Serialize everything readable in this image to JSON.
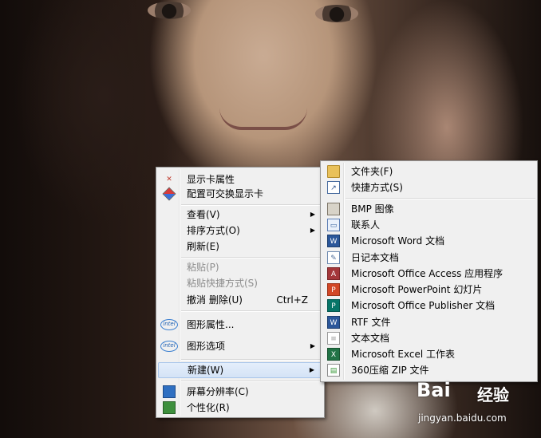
{
  "main_menu": {
    "items": [
      {
        "label": "显示卡属性",
        "icon": "graphics-properties-icon"
      },
      {
        "label": "配置可交换显示卡",
        "icon": "switchable-graphics-icon"
      },
      {
        "label": "查看(V)",
        "submenu": true
      },
      {
        "label": "排序方式(O)",
        "submenu": true
      },
      {
        "label": "刷新(E)"
      },
      {
        "label": "粘贴(P)",
        "disabled": true
      },
      {
        "label": "粘贴快捷方式(S)",
        "disabled": true
      },
      {
        "label": "撤消 删除(U)",
        "shortcut": "Ctrl+Z"
      },
      {
        "label": "图形属性...",
        "icon": "intel-icon"
      },
      {
        "label": "图形选项",
        "icon": "intel-icon",
        "submenu": true
      },
      {
        "label": "新建(W)",
        "submenu": true,
        "highlighted": true
      },
      {
        "label": "屏幕分辨率(C)",
        "icon": "monitor-icon"
      },
      {
        "label": "个性化(R)",
        "icon": "personalize-icon"
      }
    ],
    "intel_badge": "intel"
  },
  "new_submenu": {
    "items": [
      {
        "label": "文件夹(F)",
        "icon": "folder-icon"
      },
      {
        "label": "快捷方式(S)",
        "icon": "shortcut-icon"
      },
      {
        "label": "BMP 图像",
        "icon": "bmp-image-icon"
      },
      {
        "label": "联系人",
        "icon": "contact-icon"
      },
      {
        "label": "Microsoft Word 文档",
        "icon": "word-icon"
      },
      {
        "label": "日记本文档",
        "icon": "journal-icon"
      },
      {
        "label": "Microsoft Office Access 应用程序",
        "icon": "access-icon"
      },
      {
        "label": "Microsoft PowerPoint 幻灯片",
        "icon": "powerpoint-icon"
      },
      {
        "label": "Microsoft Office Publisher 文档",
        "icon": "publisher-icon"
      },
      {
        "label": "RTF 文件",
        "icon": "rtf-icon"
      },
      {
        "label": "文本文档",
        "icon": "text-document-icon"
      },
      {
        "label": "Microsoft Excel 工作表",
        "icon": "excel-icon"
      },
      {
        "label": "360压缩 ZIP 文件",
        "icon": "zip-icon"
      }
    ]
  },
  "watermark": {
    "brand": "Bai",
    "brand_cn": "经验",
    "url": "jingyan.baidu.com"
  },
  "colors": {
    "menu_bg": "#f0f0f0",
    "highlight": "#d4e3f6",
    "highlight_border": "#a8c5ea",
    "disabled_text": "#8d8d8d"
  }
}
